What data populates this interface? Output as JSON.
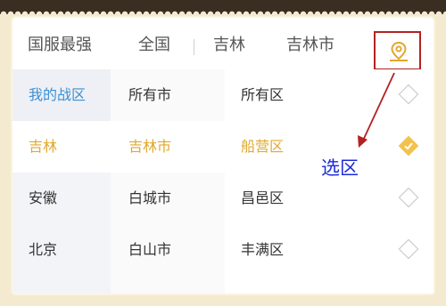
{
  "header": {
    "tab_ranking": "国服最强",
    "tab_all": "全国",
    "tab_province": "吉林",
    "tab_city": "吉林市",
    "location_icon": "location-pin-icon"
  },
  "columns": {
    "provinces": [
      "我的战区",
      "吉林",
      "安徽",
      "北京"
    ],
    "cities": [
      "所有市",
      "吉林市",
      "白城市",
      "白山市"
    ],
    "districts": [
      "所有区",
      "船营区",
      "昌邑区",
      "丰满区"
    ]
  },
  "selected_row": 1,
  "annotation": "选区",
  "colors": {
    "accent_gold": "#e0a82e",
    "my_zone_blue": "#3b8fd4",
    "annotation_red": "#b22222",
    "annotation_blue": "#1c2bd8"
  }
}
